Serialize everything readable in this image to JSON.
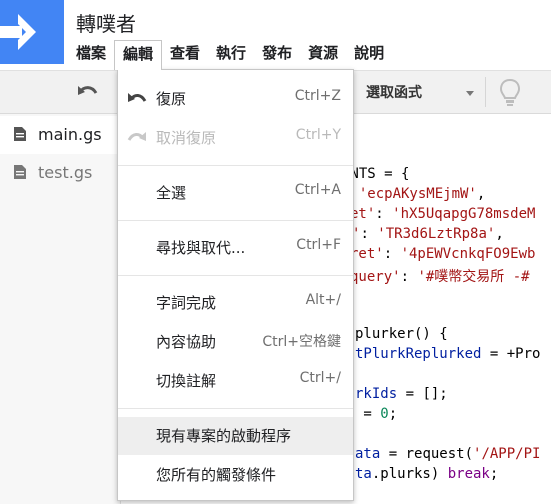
{
  "app": {
    "title": "轉噗者"
  },
  "menubar": [
    {
      "label": "檔案"
    },
    {
      "label": "編輯",
      "active": true
    },
    {
      "label": "查看"
    },
    {
      "label": "執行"
    },
    {
      "label": "發布"
    },
    {
      "label": "資源"
    },
    {
      "label": "說明"
    }
  ],
  "toolbar": {
    "function_select": "選取函式"
  },
  "files": [
    {
      "name": "main.gs",
      "selected": true
    },
    {
      "name": "test.gs",
      "selected": false
    }
  ],
  "edit_menu": {
    "undo": {
      "label": "復原",
      "shortcut": "Ctrl+Z",
      "icon": "undo-icon"
    },
    "redo": {
      "label": "取消復原",
      "shortcut": "Ctrl+Y",
      "icon": "redo-icon",
      "disabled": true
    },
    "select_all": {
      "label": "全選",
      "shortcut": "Ctrl+A"
    },
    "find_replace": {
      "label": "尋找與取代...",
      "shortcut": "Ctrl+F"
    },
    "autocomplete": {
      "label": "字詞完成",
      "shortcut": "Alt+/"
    },
    "content_assist": {
      "label": "內容協助",
      "shortcut": "Ctrl+空格鍵"
    },
    "toggle_comment": {
      "label": "切換註解",
      "shortcut": "Ctrl+/"
    },
    "project_triggers": {
      "label": "現有專案的啟動程序"
    },
    "all_triggers": {
      "label": "您所有的觸發條件"
    }
  },
  "code": {
    "line1": "ANTS = {",
    "line2a": ": ",
    "line2b": "'ecpAKysMEjmW'",
    "line2c": ",",
    "line3a": "et'",
    "line3b": ": ",
    "line3c": "'hX5UqapgG78msdeM",
    "line4a": "'",
    "line4b": ": ",
    "line4c": "'TR3d6LztRp8a'",
    "line4d": ",",
    "line5a": "ret'",
    "line5b": ": ",
    "line5c": "'4pEWVcnkqFO9Ewb",
    "line6a": "query'",
    "line6b": ": ",
    "line6c": "'#噗幣交易所 -#",
    "line7": "plurker() {",
    "line8a": "tPlurkReplurked",
    "line8b": " = +Pro",
    "line9a": "rkIds",
    "line9b": " = [];",
    "line10a": " = ",
    "line10b": "0",
    "line10c": ";",
    "line11a": "ata",
    "line11b": " = request(",
    "line11c": "'/APP/PI",
    "line12a": "ta",
    "line12b": ".plurks) ",
    "line12c": "break",
    "line12d": ";"
  }
}
